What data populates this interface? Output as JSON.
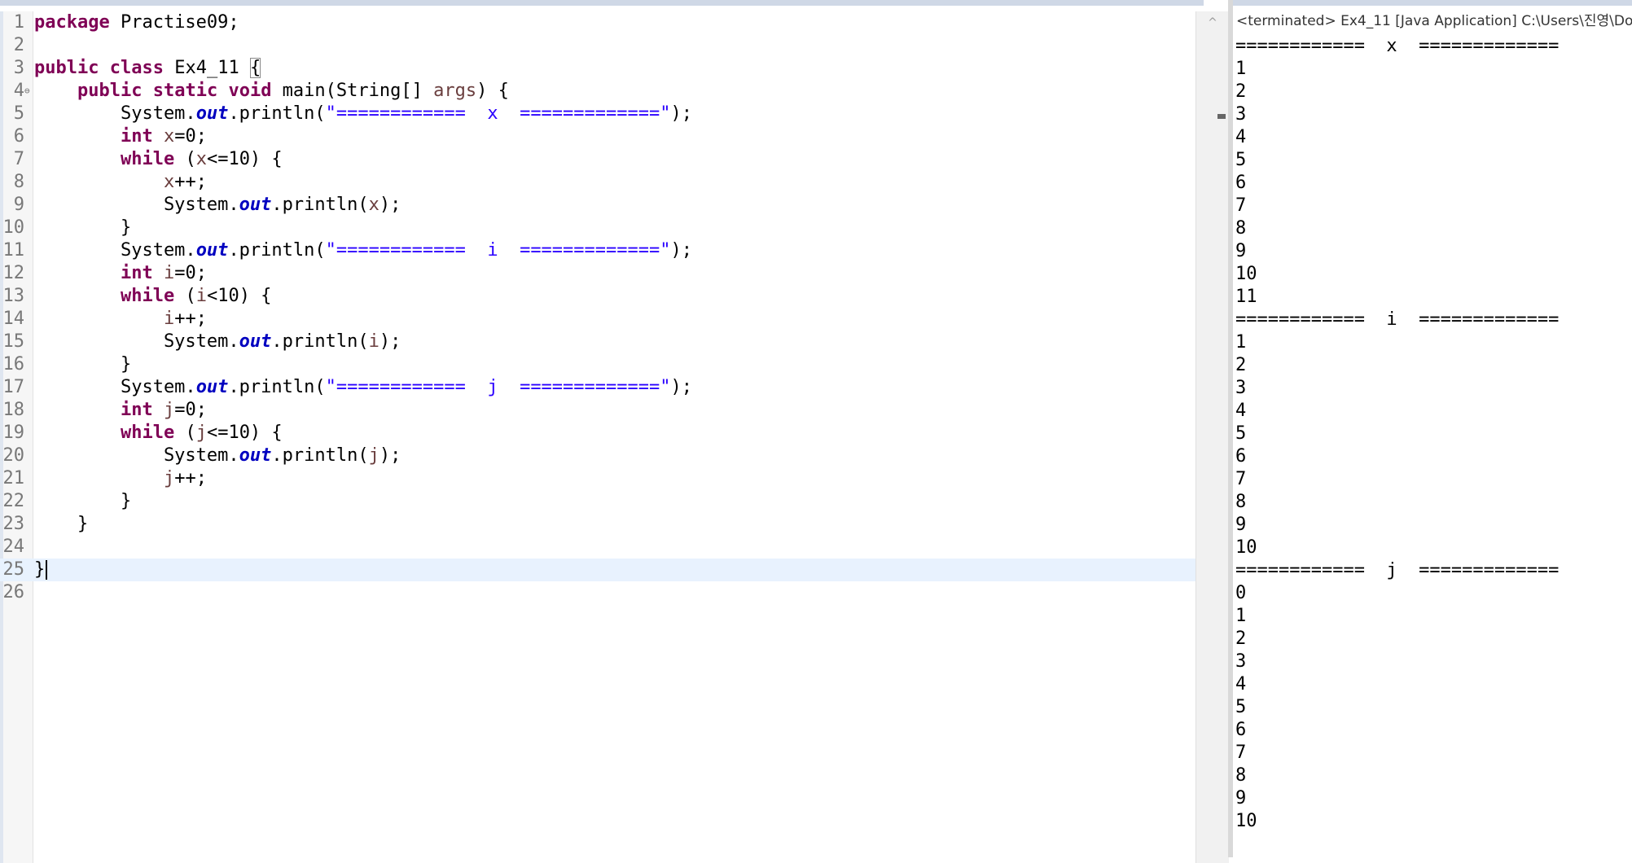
{
  "editor": {
    "lines": [
      {
        "n": "1",
        "tokens": [
          {
            "t": "package",
            "c": "kw"
          },
          {
            "t": " Practise09;"
          }
        ]
      },
      {
        "n": "2",
        "tokens": []
      },
      {
        "n": "3",
        "tokens": [
          {
            "t": "public",
            "c": "kw"
          },
          {
            "t": " "
          },
          {
            "t": "class",
            "c": "kw"
          },
          {
            "t": " Ex4_11 "
          },
          {
            "t": "{",
            "c": "bracket-box"
          }
        ]
      },
      {
        "n": "4",
        "fold": "⊖",
        "tokens": [
          {
            "t": "    "
          },
          {
            "t": "public",
            "c": "kw"
          },
          {
            "t": " "
          },
          {
            "t": "static",
            "c": "kw"
          },
          {
            "t": " "
          },
          {
            "t": "void",
            "c": "kw"
          },
          {
            "t": " main(String[] "
          },
          {
            "t": "args",
            "c": "var"
          },
          {
            "t": ") {"
          }
        ]
      },
      {
        "n": "5",
        "tokens": [
          {
            "t": "        System."
          },
          {
            "t": "out",
            "c": "fld"
          },
          {
            "t": ".println("
          },
          {
            "t": "\"============  x  =============\"",
            "c": "str"
          },
          {
            "t": ");"
          }
        ]
      },
      {
        "n": "6",
        "tokens": [
          {
            "t": "        "
          },
          {
            "t": "int",
            "c": "kw"
          },
          {
            "t": " "
          },
          {
            "t": "x",
            "c": "var"
          },
          {
            "t": "=0;"
          }
        ]
      },
      {
        "n": "7",
        "tokens": [
          {
            "t": "        "
          },
          {
            "t": "while",
            "c": "kw"
          },
          {
            "t": " ("
          },
          {
            "t": "x",
            "c": "var"
          },
          {
            "t": "<=10) {"
          }
        ]
      },
      {
        "n": "8",
        "tokens": [
          {
            "t": "            "
          },
          {
            "t": "x",
            "c": "var"
          },
          {
            "t": "++;"
          }
        ]
      },
      {
        "n": "9",
        "tokens": [
          {
            "t": "            System."
          },
          {
            "t": "out",
            "c": "fld"
          },
          {
            "t": ".println("
          },
          {
            "t": "x",
            "c": "var"
          },
          {
            "t": ");"
          }
        ]
      },
      {
        "n": "10",
        "tokens": [
          {
            "t": "        }"
          }
        ]
      },
      {
        "n": "11",
        "tokens": [
          {
            "t": "        System."
          },
          {
            "t": "out",
            "c": "fld"
          },
          {
            "t": ".println("
          },
          {
            "t": "\"============  i  =============\"",
            "c": "str"
          },
          {
            "t": ");"
          }
        ]
      },
      {
        "n": "12",
        "tokens": [
          {
            "t": "        "
          },
          {
            "t": "int",
            "c": "kw"
          },
          {
            "t": " "
          },
          {
            "t": "i",
            "c": "var"
          },
          {
            "t": "=0;"
          }
        ]
      },
      {
        "n": "13",
        "tokens": [
          {
            "t": "        "
          },
          {
            "t": "while",
            "c": "kw"
          },
          {
            "t": " ("
          },
          {
            "t": "i",
            "c": "var"
          },
          {
            "t": "<10) {"
          }
        ]
      },
      {
        "n": "14",
        "tokens": [
          {
            "t": "            "
          },
          {
            "t": "i",
            "c": "var"
          },
          {
            "t": "++;"
          }
        ]
      },
      {
        "n": "15",
        "tokens": [
          {
            "t": "            System."
          },
          {
            "t": "out",
            "c": "fld"
          },
          {
            "t": ".println("
          },
          {
            "t": "i",
            "c": "var"
          },
          {
            "t": ");"
          }
        ]
      },
      {
        "n": "16",
        "tokens": [
          {
            "t": "        }"
          }
        ]
      },
      {
        "n": "17",
        "tokens": [
          {
            "t": "        System."
          },
          {
            "t": "out",
            "c": "fld"
          },
          {
            "t": ".println("
          },
          {
            "t": "\"============  j  =============\"",
            "c": "str"
          },
          {
            "t": ");"
          }
        ]
      },
      {
        "n": "18",
        "tokens": [
          {
            "t": "        "
          },
          {
            "t": "int",
            "c": "kw"
          },
          {
            "t": " "
          },
          {
            "t": "j",
            "c": "var"
          },
          {
            "t": "=0;"
          }
        ]
      },
      {
        "n": "19",
        "tokens": [
          {
            "t": "        "
          },
          {
            "t": "while",
            "c": "kw"
          },
          {
            "t": " ("
          },
          {
            "t": "j",
            "c": "var"
          },
          {
            "t": "<=10) {"
          }
        ]
      },
      {
        "n": "20",
        "tokens": [
          {
            "t": "            System."
          },
          {
            "t": "out",
            "c": "fld"
          },
          {
            "t": ".println("
          },
          {
            "t": "j",
            "c": "var"
          },
          {
            "t": ");"
          }
        ]
      },
      {
        "n": "21",
        "tokens": [
          {
            "t": "            "
          },
          {
            "t": "j",
            "c": "var"
          },
          {
            "t": "++;"
          }
        ]
      },
      {
        "n": "22",
        "tokens": [
          {
            "t": "        }"
          }
        ]
      },
      {
        "n": "23",
        "tokens": [
          {
            "t": "    }"
          }
        ]
      },
      {
        "n": "24",
        "tokens": []
      },
      {
        "n": "25",
        "current": true,
        "tokens": [
          {
            "t": "}"
          }
        ]
      },
      {
        "n": "26",
        "tokens": []
      }
    ]
  },
  "console": {
    "title": "<terminated> Ex4_11 [Java Application] C:\\Users\\진영\\Do",
    "output": [
      "============  x  =============",
      "1",
      "2",
      "3",
      "4",
      "5",
      "6",
      "7",
      "8",
      "9",
      "10",
      "11",
      "============  i  =============",
      "1",
      "2",
      "3",
      "4",
      "5",
      "6",
      "7",
      "8",
      "9",
      "10",
      "============  j  =============",
      "0",
      "1",
      "2",
      "3",
      "4",
      "5",
      "6",
      "7",
      "8",
      "9",
      "10"
    ]
  },
  "icons": {
    "scroll_up": "chevron-up-icon",
    "fold": "collapse-icon"
  }
}
